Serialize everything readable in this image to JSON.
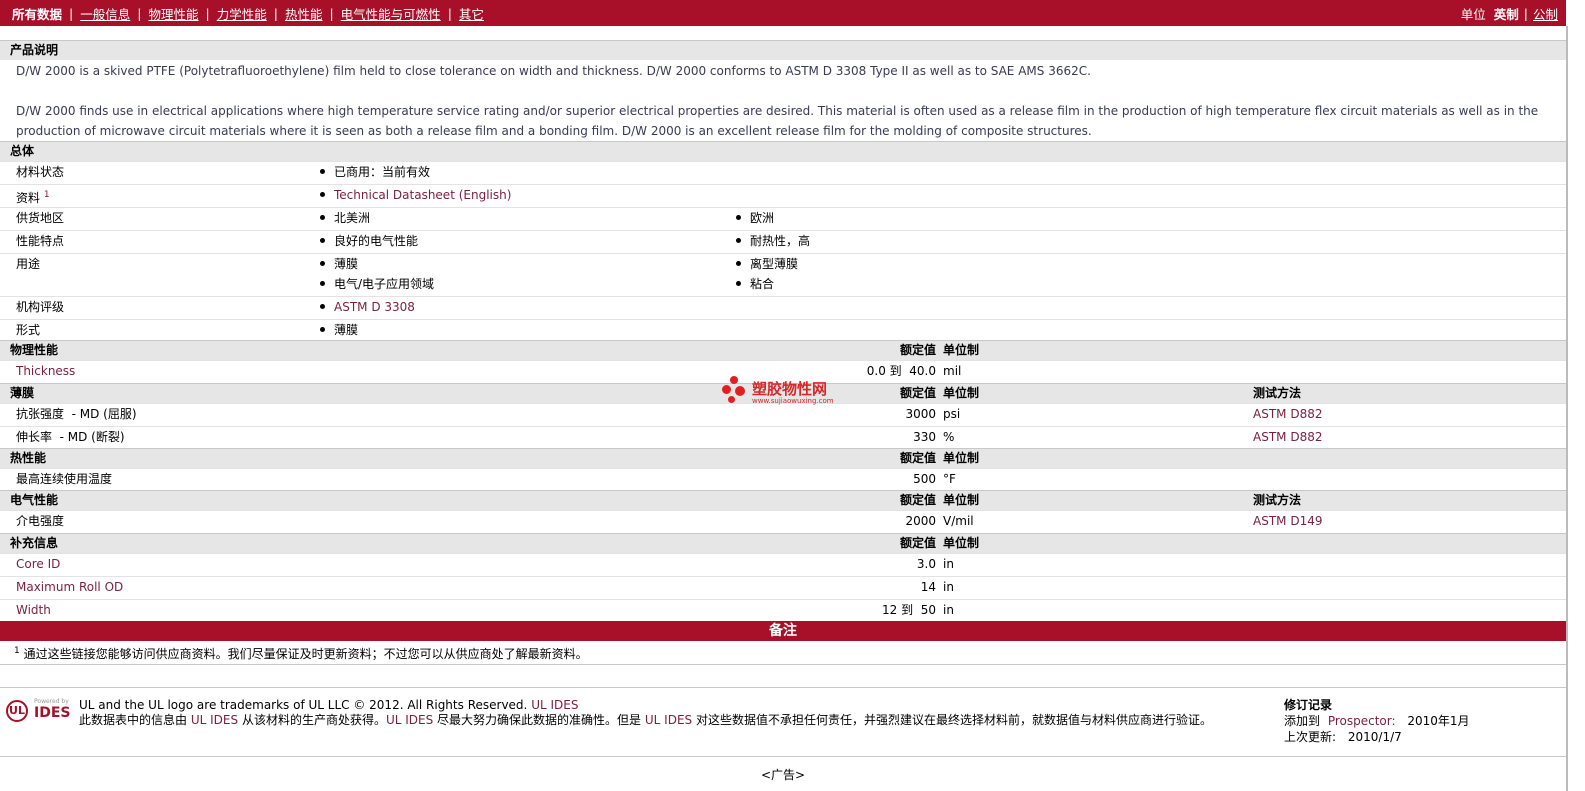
{
  "nav": {
    "items": [
      "所有数据",
      "一般信息",
      "物理性能",
      "力学性能",
      "热性能",
      "电气性能与可燃性",
      "其它"
    ],
    "units_label": "单位",
    "unit_english": "英制",
    "unit_metric": "公制"
  },
  "description": {
    "header": "产品说明",
    "p1": "D/W 2000 is a skived PTFE (Polytetrafluoroethylene) film held to close tolerance on width and thickness. D/W 2000 conforms to ASTM D 3308 Type II as well as to SAE AMS 3662C.",
    "p2": "D/W 2000 finds use in electrical applications where high temperature service rating and/or superior electrical properties are desired. This material is often used as a release film in the production of high temperature flex circuit materials as well as in the production of microwave circuit materials where it is seen as both a release film and a bonding film. D/W 2000 is an excellent release film for the molding of composite structures."
  },
  "general": {
    "header": "总体",
    "rows": [
      {
        "label": "材料状态",
        "b1": [
          "已商用：当前有效"
        ],
        "b2": []
      },
      {
        "label": "资料",
        "sup": "1",
        "b1": [
          "Technical Datasheet (English)"
        ],
        "b2": []
      },
      {
        "label": "供货地区",
        "b1": [
          "北美洲"
        ],
        "b2": [
          "欧洲"
        ]
      },
      {
        "label": "性能特点",
        "b1": [
          "良好的电气性能"
        ],
        "b2": [
          "耐热性，高"
        ]
      },
      {
        "label": "用途",
        "b1": [
          "薄膜",
          "电气/电子应用领域"
        ],
        "b2": [
          "离型薄膜",
          "粘合"
        ]
      },
      {
        "label": "机构评级",
        "b1": [
          "ASTM D 3308"
        ],
        "b2": []
      },
      {
        "label": "形式",
        "b1": [
          "薄膜"
        ],
        "b2": []
      }
    ]
  },
  "col_labels": {
    "nominal": "额定值",
    "unit": "单位制",
    "method": "测试方法"
  },
  "physical": {
    "header": "物理性能",
    "rows": [
      {
        "label": "Thickness",
        "value": "0.0 到  40.0",
        "unit": "mil",
        "method": ""
      }
    ]
  },
  "film": {
    "header": "薄膜",
    "rows": [
      {
        "label": "抗张强度  - MD (屈服)",
        "value": "3000",
        "unit": "psi",
        "method": "ASTM D882"
      },
      {
        "label": "伸长率  - MD (断裂)",
        "value": "330",
        "unit": "%",
        "method": "ASTM D882"
      }
    ]
  },
  "thermal": {
    "header": "热性能",
    "rows": [
      {
        "label": "最高连续使用温度",
        "value": "500",
        "unit": "°F",
        "method": ""
      }
    ]
  },
  "electrical": {
    "header": "电气性能",
    "rows": [
      {
        "label": "介电强度",
        "value": "2000",
        "unit": "V/mil",
        "method": "ASTM D149"
      }
    ]
  },
  "additional": {
    "header": "补充信息",
    "rows": [
      {
        "label": "Core ID",
        "value": "3.0",
        "unit": "in",
        "method": ""
      },
      {
        "label": "Maximum Roll OD",
        "value": "14",
        "unit": "in",
        "method": ""
      },
      {
        "label": "Width",
        "value": "12 到  50",
        "unit": "in",
        "method": ""
      }
    ]
  },
  "notes": {
    "header": "备注",
    "sup": "1",
    "footnote": "通过这些链接您能够访问供应商资料。我们尽量保证及时更新资料；不过您可以从供应商处了解最新资料。"
  },
  "footer": {
    "logo_powered": "Powered by",
    "logo_ul": "UL",
    "logo_ides": "IDES",
    "line1": "UL and the UL logo are trademarks of UL LLC © 2012. All Rights Reserved.",
    "line1_link": "UL IDES",
    "disclaimer_a": "此数据表中的信息由",
    "disclaimer_link1": "UL IDES",
    "disclaimer_b": "从该材料的生产商处获得。",
    "disclaimer_link2": "UL IDES",
    "disclaimer_c": "尽最大努力确保此数据的准确性。但是",
    "disclaimer_link3": "UL IDES",
    "disclaimer_d": "对这些数据值不承担任何责任，并强烈建议在最终选择材料前，就数据值与材料供应商进行验证。",
    "revision_title": "修订记录",
    "added_label": "添加到",
    "added_link": "Prospector:",
    "added_date": "2010年1月",
    "updated_label": "上次更新:",
    "updated_date": "2010/1/7",
    "ad": "<广告>"
  },
  "watermark": {
    "text": "塑胶物性网",
    "url": "www.sujiaowuxing.com"
  },
  "colors": {
    "brand": "#a8102a",
    "link": "#7a1f3d",
    "header_bg": "#e6e6e6"
  }
}
